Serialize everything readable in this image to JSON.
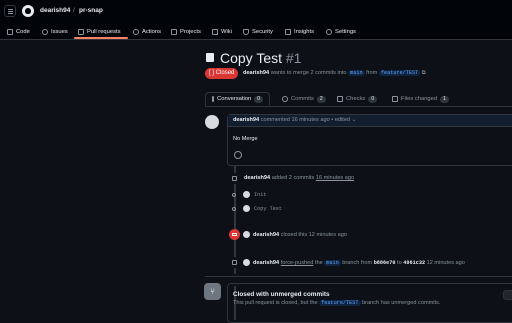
{
  "header": {
    "owner": "dearish94",
    "separator": "/",
    "repo": "pr-snap"
  },
  "repo_nav": [
    {
      "label": "Code",
      "icon": "code-icon"
    },
    {
      "label": "Issues",
      "icon": "issue-icon"
    },
    {
      "label": "Pull requests",
      "icon": "pull-request-icon"
    },
    {
      "label": "Actions",
      "icon": "play-icon"
    },
    {
      "label": "Projects",
      "icon": "table-icon"
    },
    {
      "label": "Wiki",
      "icon": "book-icon"
    },
    {
      "label": "Security",
      "icon": "shield-icon"
    },
    {
      "label": "Insights",
      "icon": "graph-icon"
    },
    {
      "label": "Settings",
      "icon": "gear-icon"
    }
  ],
  "pr": {
    "title": "Copy Test",
    "number": "#1",
    "state": "Closed",
    "author": "dearish94",
    "summary_mid": "wants to merge 2 commits into",
    "base": "main",
    "from": "from",
    "head": "feature/TEST"
  },
  "pr_tabs": [
    {
      "label": "Conversation",
      "count": "0"
    },
    {
      "label": "Commits",
      "count": "2"
    },
    {
      "label": "Checks",
      "count": "0"
    },
    {
      "label": "Files changed",
      "count": "1"
    }
  ],
  "comment": {
    "author": "dearish94",
    "meta": "commented 16 minutes ago",
    "edited": "• edited",
    "body": "No Merge"
  },
  "timeline": {
    "added": {
      "author": "dearish94",
      "text": "added 2 commits",
      "time": "16 minutes ago"
    },
    "commits": [
      "Init",
      "Copy Test"
    ],
    "closed": {
      "author": "dearish94",
      "text": "closed this 12 minutes ago"
    },
    "force": {
      "author": "dearish94",
      "action": "force-pushed",
      "the": "the",
      "branch": "main",
      "text": "branch from",
      "from_sha": "b886e70",
      "to": "to",
      "to_sha": "4961c32",
      "time": "12 minutes ago"
    }
  },
  "merge_box": {
    "title": "Closed with unmerged commits",
    "pre": "This pull request is closed, but the",
    "branch": "feature/TEST",
    "post": "branch has unmerged commits."
  }
}
